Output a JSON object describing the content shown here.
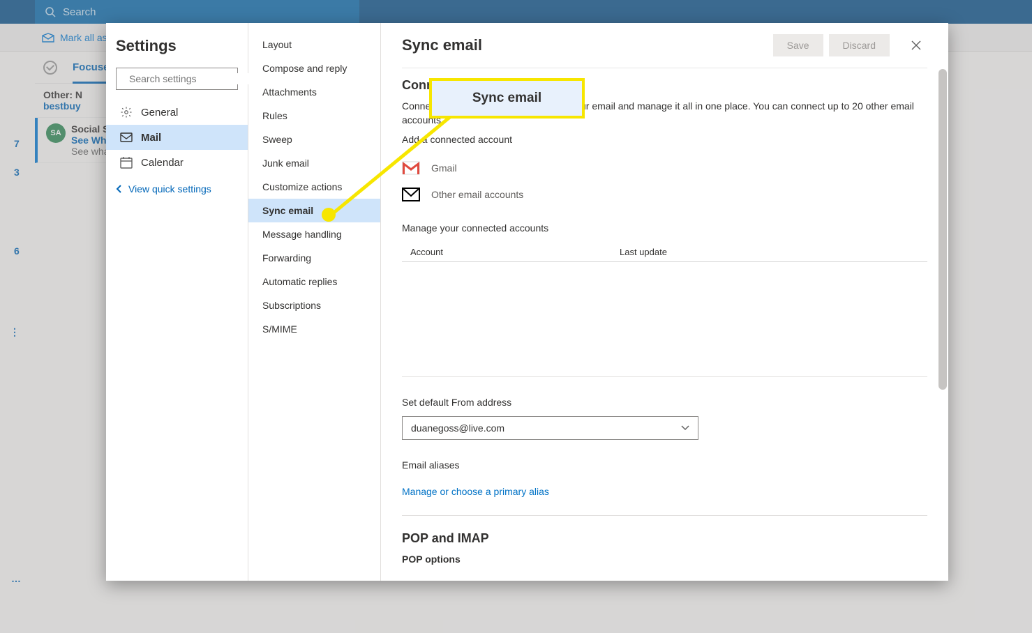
{
  "colors": {
    "accent": "#0078d4",
    "highlight": "#f7e600",
    "calloutBg": "#e8f1fc"
  },
  "topbar": {
    "search_placeholder": "Search"
  },
  "toolbar": {
    "mark_read": "Mark all as"
  },
  "left_nums": {
    "n1": "7",
    "n2": "3",
    "n3": "6"
  },
  "tabs": {
    "focused": "Focused"
  },
  "messages": [
    {
      "from": "Other: N",
      "subject": "bestbuy"
    },
    {
      "avatar": "SA",
      "from": "Social Se",
      "subject": "See Wha",
      "preview": "See what"
    }
  ],
  "settings": {
    "title": "Settings",
    "search_placeholder": "Search settings",
    "categories": [
      {
        "icon": "gear",
        "label": "General"
      },
      {
        "icon": "mail",
        "label": "Mail"
      },
      {
        "icon": "calendar",
        "label": "Calendar"
      }
    ],
    "quick_link": "View quick settings",
    "mail_subs": [
      "Layout",
      "Compose and reply",
      "Attachments",
      "Rules",
      "Sweep",
      "Junk email",
      "Customize actions",
      "Sync email",
      "Message handling",
      "Forwarding",
      "Automatic replies",
      "Subscriptions",
      "S/MIME"
    ],
    "selected_sub": "Sync email"
  },
  "pane": {
    "title": "Sync email",
    "save": "Save",
    "discard": "Discard",
    "connected_h": "Connected accounts",
    "connected_body": "Connect your other accounts to import your email and manage it all in one place. You can connect up to 20 other email accounts.",
    "add_connected": "Add a connected account",
    "gmail": "Gmail",
    "other": "Other email accounts",
    "manage_h": "Manage your connected accounts",
    "tbl_account": "Account",
    "tbl_update": "Last update",
    "default_from": "Set default From address",
    "from_value": "duanegoss@live.com",
    "aliases_h": "Email aliases",
    "aliases_link": "Manage or choose a primary alias",
    "pop_h": "POP and IMAP",
    "pop_opts": "POP options"
  },
  "callout": {
    "text": "Sync email"
  }
}
